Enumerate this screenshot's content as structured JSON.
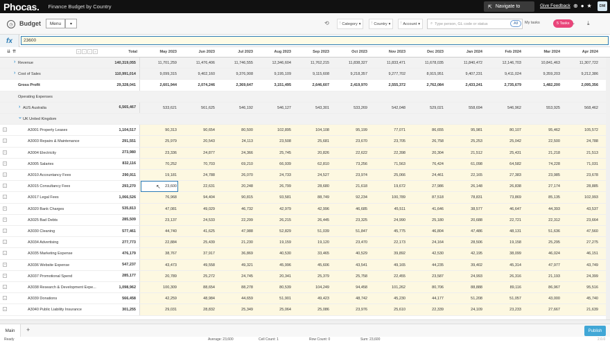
{
  "app": {
    "logo": "Phocas.",
    "title": "Finance Budget by Country",
    "navigate": "Navigate to",
    "feedback": "Give Feedback",
    "avatar": "DM"
  },
  "toolbar": {
    "budget_title": "Budget",
    "menu_label": "Menu",
    "filters": [
      "Category",
      "Country",
      "Account"
    ],
    "search_placeholder": "Type person, GL code or status",
    "all": "All",
    "my_tasks": "My tasks",
    "tasks": "5 Tasks"
  },
  "formula": {
    "fx": "fx",
    "value": "23600"
  },
  "header": {
    "total": "Total",
    "months": [
      "May 2023",
      "Jun 2023",
      "Jul 2023",
      "Aug 2023",
      "Sep 2023",
      "Oct 2023",
      "Nov 2023",
      "Dec 2023",
      "Jan 2024",
      "Feb 2024",
      "Mar 2024",
      "Apr 2024"
    ]
  },
  "rows": [
    {
      "label": "Revenue",
      "type": "gray",
      "chev": true,
      "total": "140,319,055",
      "vals": [
        "11,701,259",
        "11,476,406",
        "11,746,555",
        "12,346,604",
        "11,762,215",
        "11,838,327",
        "11,833,471",
        "11,678,035",
        "11,840,472",
        "12,146,703",
        "10,841,463",
        "11,307,722"
      ]
    },
    {
      "label": "Cost of Sales",
      "type": "gray",
      "chev": true,
      "total": "110,991,014",
      "vals": [
        "9,099,315",
        "9,402,160",
        "9,376,908",
        "9,195,109",
        "9,115,608",
        "9,218,357",
        "9,277,702",
        "8,915,951",
        "9,407,231",
        "9,411,024",
        "9,359,203",
        "9,212,386"
      ]
    },
    {
      "label": "Gross Profit",
      "type": "bold",
      "total": "29,328,041",
      "vals": [
        "2,601,944",
        "2,074,246",
        "2,369,647",
        "3,151,495",
        "2,646,607",
        "2,419,970",
        "2,555,372",
        "2,762,084",
        "2,433,241",
        "2,735,679",
        "1,482,200",
        "2,095,356"
      ]
    },
    {
      "label": "Operating Expenses",
      "type": "section",
      "total": "",
      "vals": []
    },
    {
      "label": "AUS  Australia",
      "type": "gray2",
      "chev": true,
      "total": "6,565,467",
      "vals": [
        "533,621",
        "561,625",
        "546,192",
        "546,127",
        "543,301",
        "533,269",
        "542,048",
        "529,021",
        "558,694",
        "546,962",
        "553,925",
        "568,462"
      ]
    },
    {
      "label": "UK  United Kingdom",
      "type": "uk",
      "total": "",
      "vals": []
    },
    {
      "label": "A3001  Property Leases",
      "type": "yellow",
      "total": "1,104,517",
      "vals": [
        "90,313",
        "90,654",
        "80,500",
        "102,895",
        "104,108",
        "95,199",
        "77,071",
        "86,655",
        "95,981",
        "80,107",
        "95,462",
        "105,572"
      ]
    },
    {
      "label": "A3003  Repairs & Maintenance",
      "type": "yellow",
      "total": "291,551",
      "vals": [
        "25,979",
        "20,543",
        "24,113",
        "23,508",
        "25,681",
        "23,670",
        "23,705",
        "26,758",
        "25,253",
        "25,042",
        "22,500",
        "24,788"
      ]
    },
    {
      "label": "A3004  Electricity",
      "type": "yellow",
      "total": "273,980",
      "vals": [
        "23,336",
        "24,877",
        "24,366",
        "25,745",
        "20,826",
        "22,622",
        "22,398",
        "20,304",
        "21,512",
        "25,431",
        "21,218",
        "21,513"
      ]
    },
    {
      "label": "A3005  Salaries",
      "type": "yellow",
      "total": "832,116",
      "vals": [
        "70,252",
        "70,703",
        "69,210",
        "66,939",
        "62,810",
        "73,256",
        "71,563",
        "76,424",
        "61,098",
        "64,582",
        "74,228",
        "71,031"
      ]
    },
    {
      "label": "A3010  Accountancy Fees",
      "type": "yellow",
      "total": "290,911",
      "vals": [
        "19,181",
        "24,788",
        "26,070",
        "24,733",
        "24,527",
        "23,974",
        "25,066",
        "24,461",
        "22,165",
        "27,383",
        "23,985",
        "23,678"
      ]
    },
    {
      "label": "A3015  Consultancy Fees",
      "type": "yellow",
      "total": "293,270",
      "vals": [
        "23,600",
        "22,631",
        "20,248",
        "26,799",
        "28,680",
        "21,618",
        "19,672",
        "27,986",
        "26,148",
        "26,838",
        "27,174",
        "28,885"
      ]
    },
    {
      "label": "A3017  Legal Fees",
      "type": "yellow",
      "total": "1,066,526",
      "vals": [
        "76,968",
        "94,404",
        "90,815",
        "93,581",
        "88,749",
        "92,234",
        "100,789",
        "87,518",
        "78,831",
        "73,869",
        "85,135",
        "102,993"
      ]
    },
    {
      "label": "A3020  Bank Charges",
      "type": "yellow",
      "total": "535,813",
      "vals": [
        "47,081",
        "49,029",
        "46,732",
        "42,979",
        "42,996",
        "46,685",
        "45,511",
        "41,646",
        "38,577",
        "46,647",
        "44,393",
        "43,537"
      ]
    },
    {
      "label": "A3025  Bad Debts",
      "type": "yellow",
      "total": "285,509",
      "vals": [
        "23,137",
        "24,533",
        "22,299",
        "26,215",
        "26,445",
        "23,325",
        "24,990",
        "25,180",
        "20,688",
        "22,721",
        "22,312",
        "23,664"
      ]
    },
    {
      "label": "A3030  Cleaning",
      "type": "yellow",
      "total": "577,461",
      "vals": [
        "44,740",
        "41,625",
        "47,988",
        "52,829",
        "51,039",
        "51,847",
        "45,775",
        "46,804",
        "47,486",
        "48,131",
        "51,636",
        "47,560"
      ]
    },
    {
      "label": "A3034  Advertising",
      "type": "yellow",
      "total": "277,773",
      "vals": [
        "22,884",
        "25,439",
        "21,230",
        "19,159",
        "19,120",
        "23,470",
        "22,173",
        "24,164",
        "28,506",
        "19,158",
        "25,295",
        "27,275"
      ]
    },
    {
      "label": "A3035  Marketing Expense",
      "type": "yellow",
      "total": "476,179",
      "vals": [
        "38,767",
        "37,917",
        "36,869",
        "40,530",
        "33,465",
        "40,529",
        "39,892",
        "42,530",
        "42,195",
        "38,099",
        "46,024",
        "46,151"
      ]
    },
    {
      "label": "A3036  Website Expense",
      "type": "yellow",
      "total": "547,237",
      "vals": [
        "43,473",
        "49,558",
        "49,321",
        "45,996",
        "45,606",
        "43,541",
        "49,165",
        "44,235",
        "39,402",
        "45,314",
        "47,977",
        "43,749"
      ]
    },
    {
      "label": "A3037  Promotional Spend",
      "type": "yellow",
      "total": "285,177",
      "vals": [
        "20,789",
        "25,272",
        "24,745",
        "20,341",
        "25,379",
        "25,758",
        "22,455",
        "23,587",
        "24,993",
        "26,316",
        "21,193",
        "24,399"
      ]
    },
    {
      "label": "A3038  Research & Development Expe...",
      "type": "yellow",
      "total": "1,098,962",
      "vals": [
        "100,309",
        "88,654",
        "88,278",
        "80,539",
        "104,249",
        "94,458",
        "101,262",
        "80,706",
        "88,888",
        "89,116",
        "86,967",
        "95,516"
      ]
    },
    {
      "label": "A3039  Donations",
      "type": "yellow",
      "total": "566,458",
      "vals": [
        "42,259",
        "48,984",
        "44,659",
        "51,901",
        "49,423",
        "48,742",
        "45,230",
        "44,177",
        "51,208",
        "51,057",
        "43,000",
        "45,740"
      ]
    },
    {
      "label": "A3040  Public Liability Insurance",
      "type": "yellow",
      "total": "301,255",
      "vals": [
        "29,031",
        "28,832",
        "25,349",
        "25,064",
        "25,086",
        "23,976",
        "25,610",
        "22,339",
        "24,109",
        "23,233",
        "27,667",
        "21,639"
      ]
    }
  ],
  "tabs": {
    "main": "Main",
    "add": "+",
    "publish": "Publish"
  },
  "status": {
    "ready": "Ready",
    "average": "Average: 23,600",
    "cell_count": "Cell Count: 1",
    "row_count": "Row Count: 0",
    "sum": "Sum: 23,600",
    "version": "2.0.0"
  }
}
